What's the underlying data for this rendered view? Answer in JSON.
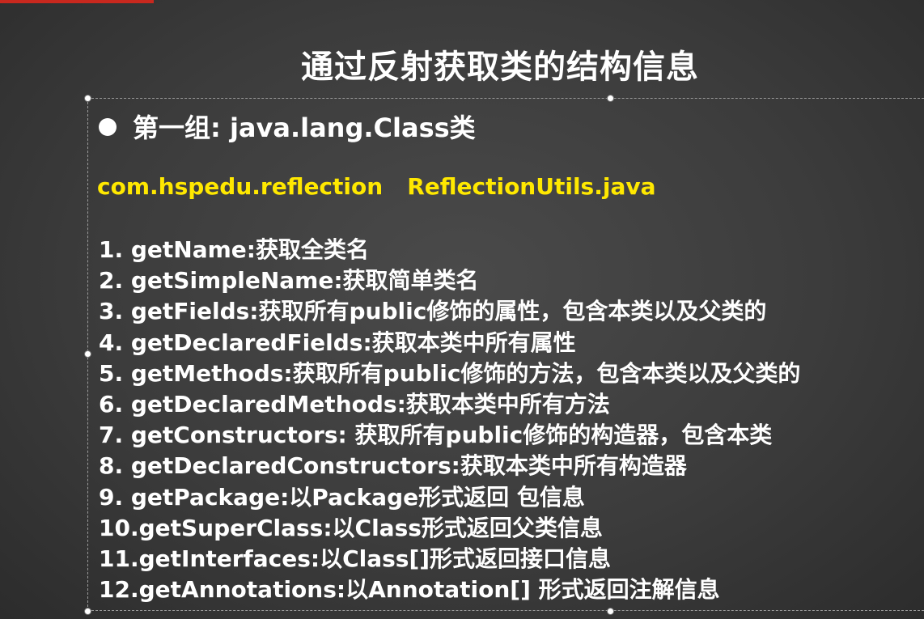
{
  "slide": {
    "title": "通过反射获取类的结构信息",
    "group_heading": "第一组: java.lang.Class类",
    "package_path": "com.hspedu.reflection",
    "file_name": "ReflectionUtils.java",
    "methods": [
      "1.  getName:获取全类名",
      "2.  getSimpleName:获取简单类名",
      "3.  getFields:获取所有public修饰的属性，包含本类以及父类的",
      "4.  getDeclaredFields:获取本类中所有属性",
      "5.  getMethods:获取所有public修饰的方法，包含本类以及父类的",
      "6.  getDeclaredMethods:获取本类中所有方法",
      "7.  getConstructors: 获取所有public修饰的构造器，包含本类",
      "8.  getDeclaredConstructors:获取本类中所有构造器",
      "9.  getPackage:以Package形式返回 包信息",
      "10.getSuperClass:以Class形式返回父类信息",
      "11.getInterfaces:以Class[]形式返回接口信息",
      "12.getAnnotations:以Annotation[] 形式返回注解信息"
    ]
  },
  "colors": {
    "background": "#3c3c3c",
    "text": "#ffffff",
    "highlight": "#ffe800",
    "accent": "#c8281e"
  }
}
